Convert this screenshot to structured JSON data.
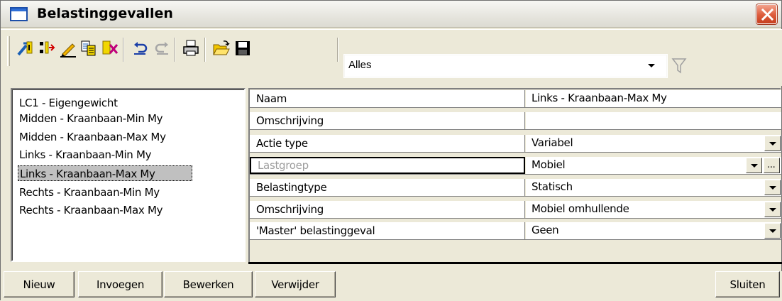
{
  "window": {
    "title": "Belastinggevallen"
  },
  "toolbar": {
    "buttons": [
      {
        "icon": "new-loadcase-icon"
      },
      {
        "icon": "insert-icon"
      },
      {
        "icon": "edit-pencil-icon"
      },
      {
        "icon": "copy-icon"
      },
      {
        "icon": "delete-icon"
      },
      {
        "icon": "undo-icon"
      },
      {
        "icon": "redo-icon"
      },
      {
        "icon": "print-icon"
      },
      {
        "icon": "open-folder-icon"
      },
      {
        "icon": "save-disk-icon"
      }
    ],
    "filter_value": "Alles",
    "filter_icon": "filter-funnel-icon"
  },
  "loadcases": {
    "items": [
      "LC1 - Eigengewicht",
      "Midden - Kraanbaan-Min My",
      "Midden - Kraanbaan-Max My",
      "Links - Kraanbaan-Min My",
      "Links - Kraanbaan-Max My",
      "Rechts - Kraanbaan-Min My",
      "Rechts - Kraanbaan-Max My"
    ],
    "selected": "Links - Kraanbaan-Max My"
  },
  "properties": {
    "rows": [
      {
        "name": "Naam",
        "value": "Links - Kraanbaan-Max My"
      },
      {
        "name": "Omschrijving",
        "value": ""
      },
      {
        "name": "Actie type",
        "value": "Variabel"
      },
      {
        "name": "Lastgroep",
        "value": "Mobiel",
        "extra_button": "..."
      },
      {
        "name": "Belastingtype",
        "value": "Statisch"
      },
      {
        "name": "Omschrijving",
        "value": "Mobiel omhullende"
      },
      {
        "name": "'Master' belastinggeval",
        "value": "Geen"
      }
    ]
  },
  "buttons": {
    "new": "Nieuw",
    "insert": "Invoegen",
    "edit": "Bewerken",
    "delete": "Verwijder",
    "close": "Sluiten"
  }
}
